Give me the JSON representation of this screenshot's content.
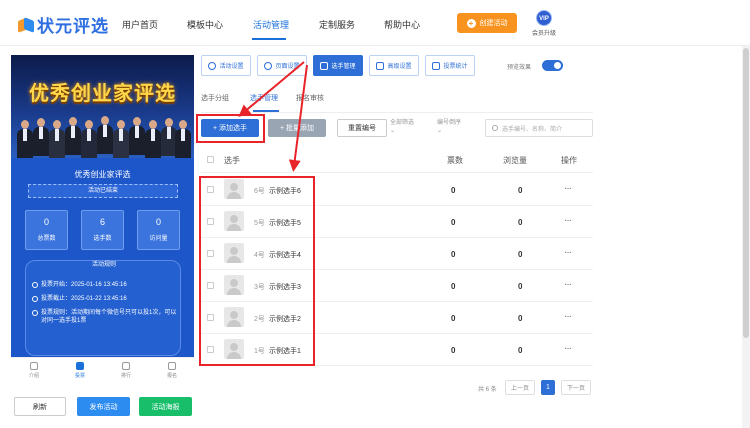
{
  "brand": {
    "name": "状元评选"
  },
  "nav": {
    "items": [
      "用户首页",
      "模板中心",
      "活动管理",
      "定制服务",
      "帮助中心"
    ],
    "active_index": 2,
    "create_label": "创建活动",
    "vip_badge": "VIP",
    "vip_label": "会员升级"
  },
  "phone": {
    "banner_title": "优秀创业家评选",
    "contest_name": "优秀创业家评选",
    "status": "活动已结束",
    "stats": [
      {
        "value": "0",
        "label": "总票数"
      },
      {
        "value": "6",
        "label": "选手数"
      },
      {
        "value": "0",
        "label": "访问量"
      }
    ],
    "rules_title": "活动规则",
    "rules": [
      "投票开始：2025-01-16 13:45:16",
      "投票截止：2025-01-22 13:45:16",
      "投票规则：活动期间每个微信号只可以投1次，可以对同一选手投1票"
    ],
    "tabs": [
      "介绍",
      "投票",
      "排行",
      "报名"
    ],
    "active_tab": 1
  },
  "bottom_actions": {
    "refresh": "刷新",
    "publish": "发布活动",
    "poster": "活动海报"
  },
  "colors": {
    "primary": "#2d6fd6",
    "orange": "#f7931e",
    "green": "#19be6b",
    "annotation": "#e8232a"
  },
  "sections": {
    "buttons": [
      "活动设置",
      "页面设置",
      "选手管理",
      "高级设置",
      "投票统计"
    ],
    "active_index": 2,
    "preview_label": "预览效果",
    "preview_on": true
  },
  "subtabs": {
    "items": [
      "选手分组",
      "选手管理",
      "报名审核"
    ],
    "active_index": 1
  },
  "toolbar": {
    "add": "+ 添加选手",
    "bulk": "+ 批量添加",
    "reorder": "重置编号",
    "filter_all": "全部筛选",
    "sort": "编号倒序",
    "search_placeholder": "选手编号、名称、简介"
  },
  "table": {
    "columns": [
      "选手",
      "票数",
      "浏览量",
      "操作"
    ],
    "rows": [
      {
        "no": "6号",
        "name": "示例选手6",
        "votes": "0",
        "views": "0",
        "more": "···"
      },
      {
        "no": "5号",
        "name": "示例选手5",
        "votes": "0",
        "views": "0",
        "more": "···"
      },
      {
        "no": "4号",
        "name": "示例选手4",
        "votes": "0",
        "views": "0",
        "more": "···"
      },
      {
        "no": "3号",
        "name": "示例选手3",
        "votes": "0",
        "views": "0",
        "more": "···"
      },
      {
        "no": "2号",
        "name": "示例选手2",
        "votes": "0",
        "views": "0",
        "more": "···"
      },
      {
        "no": "1号",
        "name": "示例选手1",
        "votes": "0",
        "views": "0",
        "more": "···"
      }
    ]
  },
  "pagination": {
    "total": "共 6 条",
    "prev": "上一页",
    "current": "1",
    "next": "下一页"
  }
}
